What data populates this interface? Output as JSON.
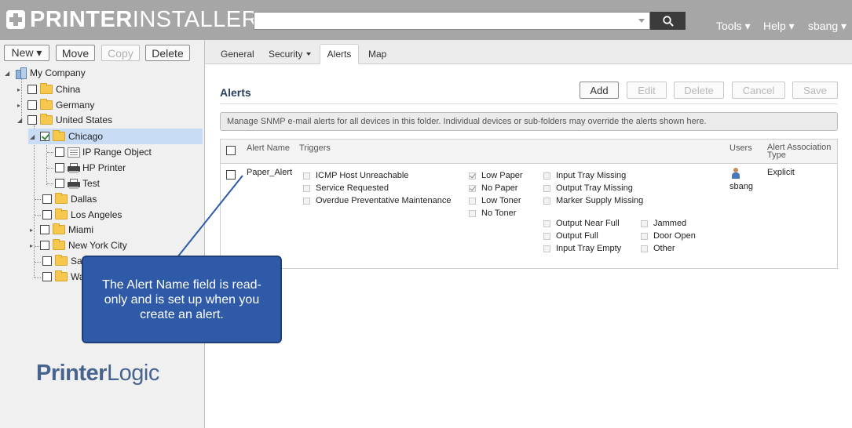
{
  "header": {
    "logo_bold": "PRINTER",
    "logo_light": "INSTALLER",
    "search_placeholder": "",
    "menu": {
      "tools": "Tools ▾",
      "help": "Help ▾",
      "user": "sbang ▾"
    }
  },
  "toolbar": {
    "new": "New ▾",
    "move": "Move",
    "copy": "Copy",
    "delete": "Delete"
  },
  "tree": {
    "root": "My Company",
    "items": [
      {
        "label": "China"
      },
      {
        "label": "Germany"
      },
      {
        "label": "United States"
      },
      {
        "label": "Chicago"
      },
      {
        "label": "IP Range Object"
      },
      {
        "label": "HP Printer"
      },
      {
        "label": "Test"
      },
      {
        "label": "Dallas"
      },
      {
        "label": "Los Angeles"
      },
      {
        "label": "Miami"
      },
      {
        "label": "New York City"
      },
      {
        "label": "San"
      },
      {
        "label": "Wa"
      }
    ]
  },
  "brand": {
    "bold": "Printer",
    "light": "Logic"
  },
  "tabs": [
    {
      "label": "General"
    },
    {
      "label": "Security"
    },
    {
      "label": "Alerts"
    },
    {
      "label": "Map"
    }
  ],
  "alerts": {
    "title": "Alerts",
    "buttons": {
      "add": "Add",
      "edit": "Edit",
      "delete": "Delete",
      "cancel": "Cancel",
      "save": "Save"
    },
    "info": "Manage SNMP e-mail alerts for all devices in this folder. Individual devices or sub-folders may override the alerts shown here.",
    "columns": {
      "name": "Alert Name",
      "triggers": "Triggers",
      "users": "Users",
      "type_line1": "Alert Association",
      "type_line2": "Type"
    },
    "row": {
      "name": "Paper_Alert",
      "user": "sbang",
      "type": "Explicit",
      "triggers": [
        {
          "label": "ICMP Host Unreachable",
          "checked": false
        },
        {
          "label": "Service Requested",
          "checked": false
        },
        {
          "label": "Overdue Preventative Maintenance",
          "checked": false
        },
        {
          "label": "Low Paper",
          "checked": true
        },
        {
          "label": "No Paper",
          "checked": true
        },
        {
          "label": "Low Toner",
          "checked": false
        },
        {
          "label": "No Toner",
          "checked": false
        },
        {
          "label": "Input Tray Missing",
          "checked": false
        },
        {
          "label": "Output Tray Missing",
          "checked": false
        },
        {
          "label": "Marker Supply Missing",
          "checked": false
        },
        {
          "label": "Output Near Full",
          "checked": false
        },
        {
          "label": "Output Full",
          "checked": false
        },
        {
          "label": "Input Tray Empty",
          "checked": false
        },
        {
          "label": "Jammed",
          "checked": false
        },
        {
          "label": "Door Open",
          "checked": false
        },
        {
          "label": "Other",
          "checked": false
        }
      ]
    }
  },
  "callout": {
    "text": "The Alert Name field is read-only and is set up when you create an alert."
  },
  "colors": {
    "header_bg": "#a6a6a6",
    "callout_bg": "#2e5aa7",
    "brand": "#46648f",
    "title": "#2b3f5c"
  }
}
